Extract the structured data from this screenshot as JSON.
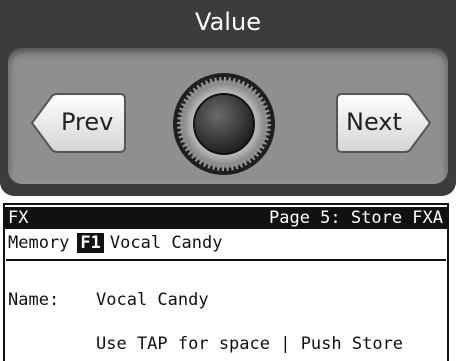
{
  "panel": {
    "title": "Value",
    "prev_label": "Prev",
    "next_label": "Next",
    "knob_icon": "rotary-encoder-knob"
  },
  "lcd": {
    "title_left": "FX",
    "title_right": "Page 5: Store FXA",
    "memory_label": "Memory",
    "memory_slot": "F1",
    "memory_name": "Vocal Candy",
    "name_label": "Name:",
    "name_value": "Vocal Candy",
    "hint": "Use TAP for space | Push Store"
  }
}
